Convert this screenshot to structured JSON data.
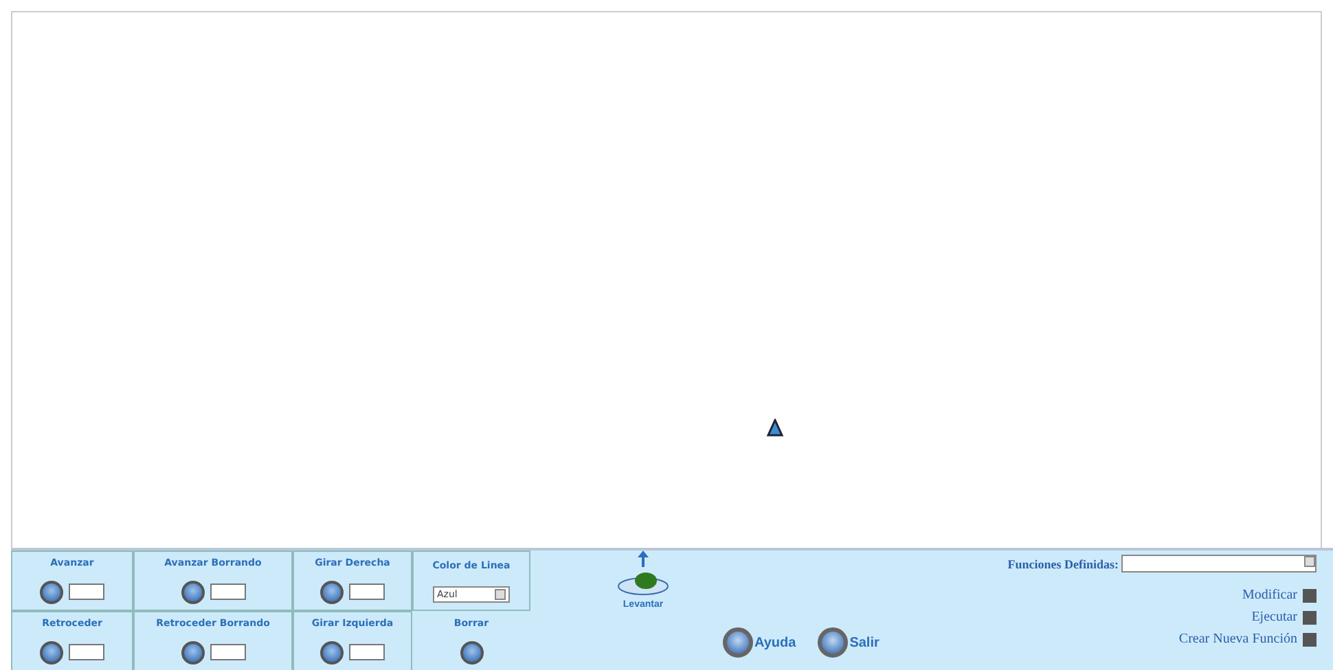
{
  "commands": [
    {
      "label": "Avanzar",
      "kind": "step"
    },
    {
      "label": "Avanzar Borrando",
      "kind": "step"
    },
    {
      "label": "Girar Derecha",
      "kind": "step"
    },
    {
      "label": "Color de Linea",
      "kind": "color",
      "value": "Azul"
    },
    {
      "label": "Retroceder",
      "kind": "step"
    },
    {
      "label": "Retroceder Borrando",
      "kind": "step"
    },
    {
      "label": "Girar Izquierda",
      "kind": "step"
    },
    {
      "label": "Borrar",
      "kind": "action"
    }
  ],
  "pen": {
    "label": "Levantar"
  },
  "buttons": [
    {
      "label": "Ayuda"
    },
    {
      "label": "Salir"
    }
  ],
  "functions": {
    "label": "Funciones Definidas:",
    "actions": [
      {
        "label": "Modificar"
      },
      {
        "label": "Ejecutar"
      },
      {
        "label": "Crear Nueva Función"
      }
    ]
  }
}
